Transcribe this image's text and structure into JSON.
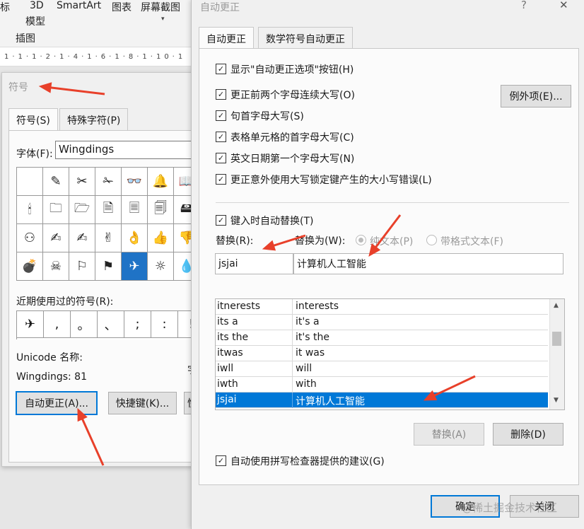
{
  "ribbon": {
    "items": [
      {
        "label": "标"
      },
      {
        "label": "3D"
      },
      {
        "label": "模型"
      },
      {
        "label": "SmartArt"
      },
      {
        "label": "图表"
      },
      {
        "label": "屏幕截图"
      }
    ],
    "caret": "▾",
    "group_label": "插图",
    "ruler_marks": "1·1·1·2·1·4·1·6·1·8·1·10·1"
  },
  "symbol_dialog": {
    "title": "符号",
    "tabs": [
      {
        "label": "符号(S)"
      },
      {
        "label": "特殊字符(P)"
      }
    ],
    "font_label": "字体(F):",
    "font_value": "Wingdings",
    "grid": [
      [
        "",
        "✎",
        "✂",
        "✁",
        "👓",
        "🔔",
        "📖"
      ],
      [
        "🕯",
        "🗀",
        "🗁",
        "🗎",
        "🗏",
        "🗐",
        "🖴"
      ],
      [
        "⚇",
        "✍",
        "✍",
        "✌",
        "👌",
        "👍",
        "👎"
      ],
      [
        "💣",
        "☠",
        "⚐",
        "⚑",
        "✈",
        "☼",
        "💧"
      ]
    ],
    "selected_symbol": "✈",
    "recent_label": "近期使用过的符号(R):",
    "recent": [
      "✈",
      ",",
      "。",
      "、",
      ";",
      ":",
      "!"
    ],
    "unicode_label": "Unicode 名称:",
    "code_label": "Wingdings: 81",
    "side_char": "字",
    "buttons": {
      "autocorrect": "自动更正(A)...",
      "shortcut": "快捷键(K)...",
      "side": "快"
    }
  },
  "autocorrect": {
    "title": "自动更正",
    "title_buttons": {
      "help": "?",
      "close": "✕"
    },
    "tabs": [
      {
        "label": "自动更正"
      },
      {
        "label": "数学符号自动更正"
      }
    ],
    "options": [
      {
        "label": "显示\"自动更正选项\"按钮(H)",
        "checked": true
      },
      {
        "label": "更正前两个字母连续大写(O)",
        "checked": true
      },
      {
        "label": "句首字母大写(S)",
        "checked": true
      },
      {
        "label": "表格单元格的首字母大写(C)",
        "checked": true
      },
      {
        "label": "英文日期第一个字母大写(N)",
        "checked": true
      },
      {
        "label": "更正意外使用大写锁定键产生的大小写错误(L)",
        "checked": true
      }
    ],
    "exceptions_button": "例外项(E)...",
    "replace_as_type": {
      "label": "键入时自动替换(T)",
      "checked": true
    },
    "replace_label": "替换(R):",
    "with_label": "替换为(W):",
    "plain_text_label": "纯文本(P)",
    "formatted_text_label": "带格式文本(F)",
    "replace_value": "jsjai",
    "with_value": "计算机人工智能",
    "entries": [
      {
        "from": "itnerests",
        "to": "interests"
      },
      {
        "from": "its a",
        "to": "it's a"
      },
      {
        "from": "its the",
        "to": "it's the"
      },
      {
        "from": "itwas",
        "to": "it was"
      },
      {
        "from": "iwll",
        "to": "will"
      },
      {
        "from": "iwth",
        "to": "with"
      },
      {
        "from": "jsjai",
        "to": "计算机人工智能"
      }
    ],
    "selected_entry": 6,
    "buttons": {
      "replace": "替换(A)",
      "delete": "删除(D)",
      "ok": "确定",
      "close": "关闭"
    },
    "spell_suggest": {
      "label": "自动使用拼写检查器提供的建议(G)",
      "checked": true
    },
    "check_mark": "✓",
    "scroll_up": "▲",
    "scroll_down": "▼"
  },
  "watermark": "@稀土掘金技术社区",
  "annotation_color": "#e8402a"
}
